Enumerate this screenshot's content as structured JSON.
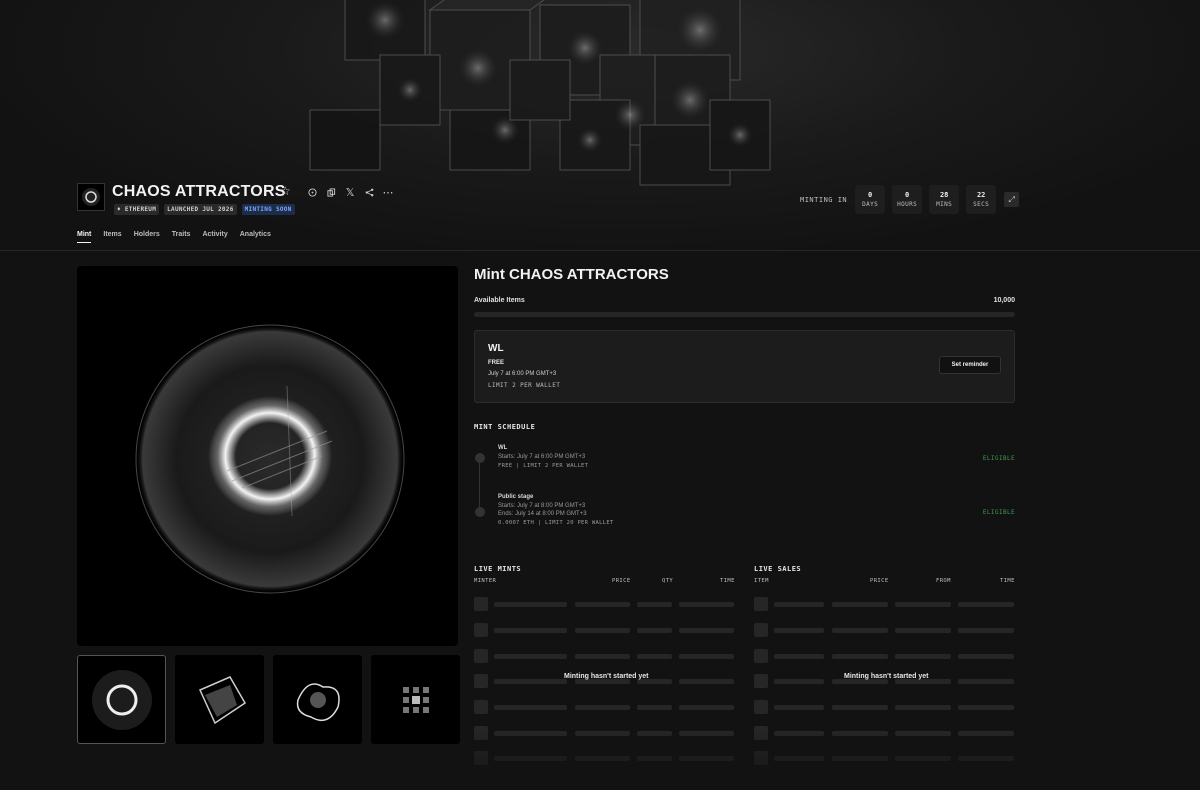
{
  "collection": {
    "name": "CHAOS ATTRACTORS",
    "badges": [
      "♦ ETHEREUM",
      "LAUNCHED JUL 2026",
      "MINTING SOON"
    ],
    "header_icons": [
      "star-icon",
      "info-icon",
      "copy-icon",
      "x-icon",
      "share-icon",
      "more-icon"
    ]
  },
  "countdown": {
    "label": "MINTING IN",
    "units": [
      {
        "value": "0",
        "unit": "DAYS"
      },
      {
        "value": "0",
        "unit": "HOURS"
      },
      {
        "value": "28",
        "unit": "MINS"
      },
      {
        "value": "22",
        "unit": "SECS"
      }
    ]
  },
  "tabs": [
    "Mint",
    "Items",
    "Holders",
    "Traits",
    "Activity",
    "Analytics"
  ],
  "active_tab": "Mint",
  "mint": {
    "title": "Mint CHAOS ATTRACTORS",
    "available_label": "Available Items",
    "available_value": "10,000",
    "minted_fraction": 0,
    "wl_card": {
      "name": "WL",
      "price": "FREE",
      "date": "July 7 at 6:00 PM GMT+3",
      "limit": "LIMIT 2 PER WALLET",
      "button": "Set reminder"
    },
    "schedule_title": "MINT SCHEDULE",
    "stages": [
      {
        "name": "WL",
        "lines": [
          "Starts: July 7 at 6:00 PM GMT+3"
        ],
        "meta": "FREE | LIMIT 2 PER WALLET",
        "status": "ELIGIBLE"
      },
      {
        "name": "Public stage",
        "lines": [
          "Starts: July 7 at 8:00 PM GMT+3",
          "Ends: July 14 at 8:00 PM GMT+3"
        ],
        "meta": "0.0007 ETH | LIMIT 20 PER WALLET",
        "status": "ELIGIBLE"
      }
    ]
  },
  "live_mints": {
    "title": "LIVE MINTS",
    "columns": [
      "MINTER",
      "PRICE",
      "QTY",
      "TIME"
    ],
    "empty_message": "Minting hasn't started yet"
  },
  "live_sales": {
    "title": "LIVE SALES",
    "columns": [
      "ITEM",
      "PRICE",
      "FROM",
      "TIME"
    ],
    "empty_message": "Minting hasn't started yet"
  },
  "colors": {
    "background": "#121212",
    "card": "#1c1c1c",
    "eligible": "#3f9a4f",
    "badge_blue": "#7ea6ff"
  }
}
